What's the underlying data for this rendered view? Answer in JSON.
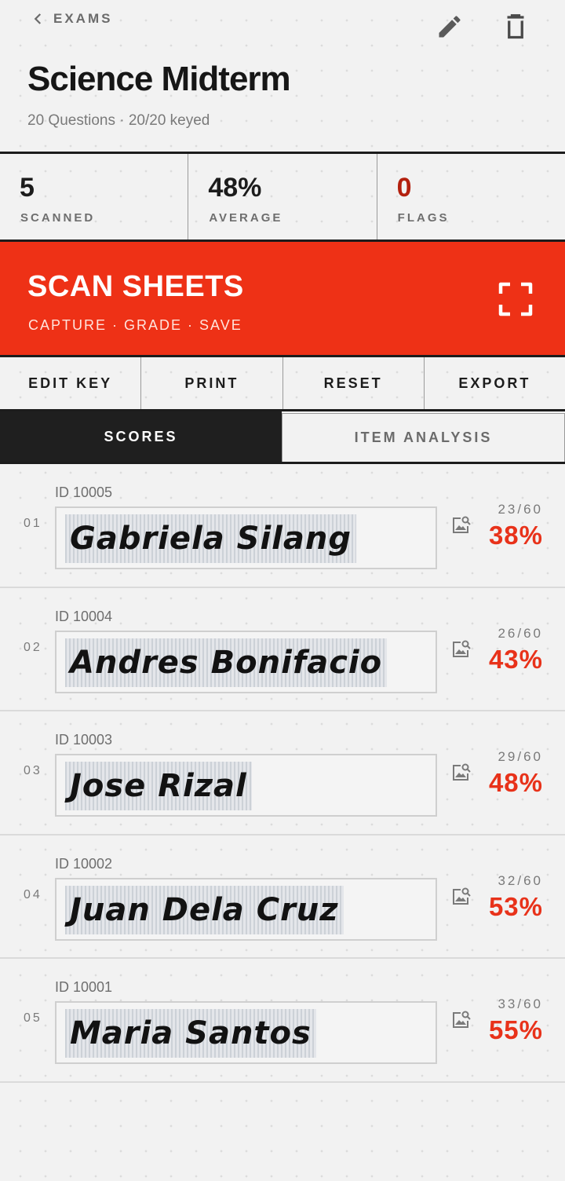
{
  "header": {
    "back_label": "EXAMS",
    "title": "Science Midterm",
    "subtitle": "20 Questions · 20/20 keyed"
  },
  "stats": [
    {
      "value": "5",
      "label": "SCANNED"
    },
    {
      "value": "48%",
      "label": "AVERAGE"
    },
    {
      "value": "0",
      "label": "FLAGS"
    }
  ],
  "scan": {
    "title": "SCAN SHEETS",
    "subtitle": "CAPTURE · GRADE · SAVE"
  },
  "actions": [
    "EDIT KEY",
    "PRINT",
    "RESET",
    "EXPORT"
  ],
  "tabs": [
    {
      "label": "SCORES",
      "active": true
    },
    {
      "label": "ITEM ANALYSIS",
      "active": false
    }
  ],
  "colors": {
    "accent": "#ee3116",
    "score": "#e8321a",
    "flags": "#b3200e",
    "dark": "#1c1c1c"
  },
  "scores": [
    {
      "num": "01",
      "id": "ID 10005",
      "name": "Gabriela Silang",
      "fraction": "23/60",
      "percent": "38%"
    },
    {
      "num": "02",
      "id": "ID 10004",
      "name": "Andres Bonifacio",
      "fraction": "26/60",
      "percent": "43%"
    },
    {
      "num": "03",
      "id": "ID 10003",
      "name": "Jose Rizal",
      "fraction": "29/60",
      "percent": "48%"
    },
    {
      "num": "04",
      "id": "ID 10002",
      "name": "Juan Dela Cruz",
      "fraction": "32/60",
      "percent": "53%"
    },
    {
      "num": "05",
      "id": "ID 10001",
      "name": "Maria Santos",
      "fraction": "33/60",
      "percent": "55%"
    }
  ]
}
